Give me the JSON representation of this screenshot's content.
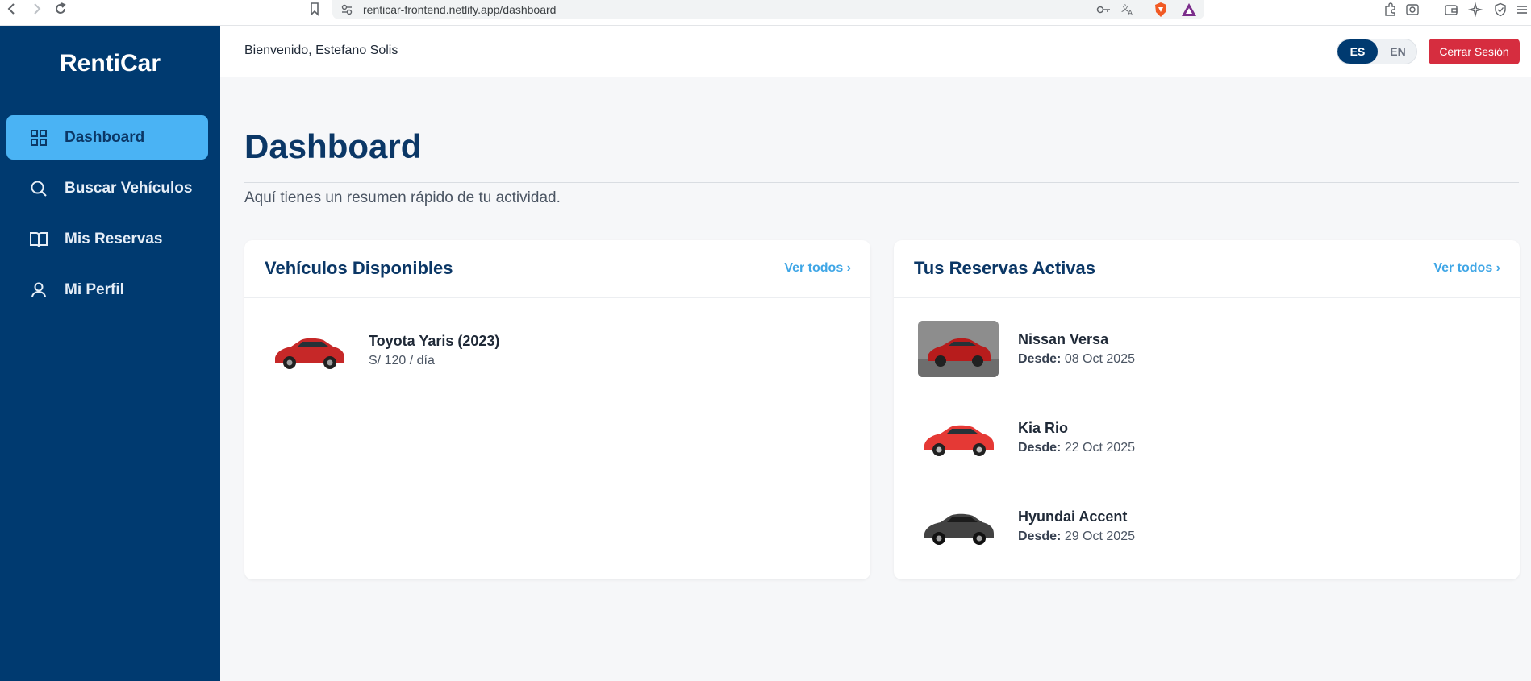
{
  "browser": {
    "url": "renticar-frontend.netlify.app/dashboard"
  },
  "sidebar": {
    "brand": "RentiCar",
    "items": [
      {
        "label": "Dashboard",
        "icon": "grid-icon",
        "active": true
      },
      {
        "label": "Buscar Vehículos",
        "icon": "search-icon",
        "active": false
      },
      {
        "label": "Mis Reservas",
        "icon": "book-icon",
        "active": false
      },
      {
        "label": "Mi Perfil",
        "icon": "user-icon",
        "active": false
      }
    ]
  },
  "header": {
    "welcome": "Bienvenido, Estefano Solis",
    "lang_es": "ES",
    "lang_en": "EN",
    "logout": "Cerrar Sesión"
  },
  "main": {
    "title": "Dashboard",
    "subtitle": "Aquí tienes un resumen rápido de tu actividad."
  },
  "available": {
    "title": "Vehículos Disponibles",
    "link": "Ver todos ›",
    "items": [
      {
        "name": "Toyota Yaris (2023)",
        "price": "S/ 120 / día",
        "color": "#c62828"
      }
    ]
  },
  "reservations": {
    "title": "Tus Reservas Activas",
    "link": "Ver todos ›",
    "since_label": "Desde:",
    "items": [
      {
        "name": "Nissan Versa",
        "date": "08 Oct 2025",
        "color": "#b71c1c"
      },
      {
        "name": "Kia Rio",
        "date": "22 Oct 2025",
        "color": "#e53935"
      },
      {
        "name": "Hyundai Accent",
        "date": "29 Oct 2025",
        "color": "#424242"
      }
    ]
  },
  "colors": {
    "sidebar_bg": "#003a70",
    "active_item": "#4ab3f4",
    "accent_link": "#3fa6e6",
    "logout_bg": "#d62d3f"
  }
}
